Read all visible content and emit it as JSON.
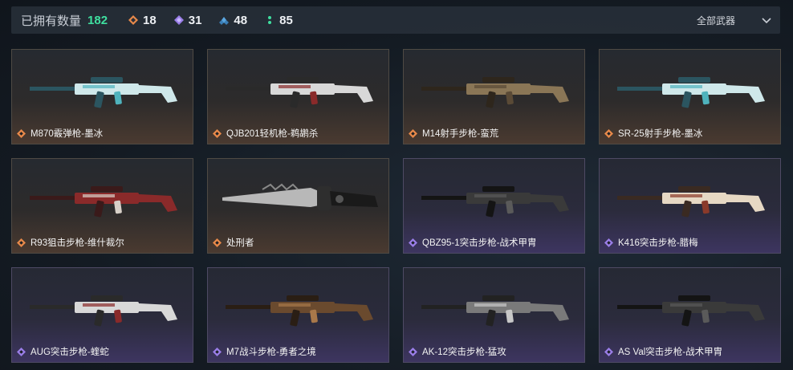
{
  "header": {
    "owned_label": "已拥有数量",
    "owned_count": "182",
    "stats": [
      {
        "icon": "orange-diamond-icon",
        "color": "#e8894a",
        "value": "18"
      },
      {
        "icon": "purple-diamond-icon",
        "color": "#9a7ee8",
        "value": "31"
      },
      {
        "icon": "blue-diamond-icon",
        "color": "#5aa6e0",
        "value": "48"
      },
      {
        "icon": "green-dots-icon",
        "color": "#3fe0a0",
        "value": "85"
      }
    ],
    "filter_label": "全部武器"
  },
  "weapons": [
    {
      "name": "M870霰弹枪-墨冰",
      "rarity": "orange",
      "palette": "ice"
    },
    {
      "name": "QJB201轻机枪-鹈鹕杀",
      "rarity": "orange",
      "palette": "white"
    },
    {
      "name": "M14射手步枪-蛮荒",
      "rarity": "orange",
      "palette": "tan"
    },
    {
      "name": "SR-25射手步枪-墨冰",
      "rarity": "orange",
      "palette": "ice"
    },
    {
      "name": "R93狙击步枪-维什裁尔",
      "rarity": "orange",
      "palette": "red"
    },
    {
      "name": "处刑者",
      "rarity": "orange",
      "palette": "knife"
    },
    {
      "name": "QBZ95-1突击步枪-战术甲胄",
      "rarity": "purple",
      "palette": "black"
    },
    {
      "name": "K416突击步枪-腊梅",
      "rarity": "purple",
      "palette": "cream"
    },
    {
      "name": "AUG突击步枪-蝰蛇",
      "rarity": "purple",
      "palette": "white"
    },
    {
      "name": "M7战斗步枪-勇者之境",
      "rarity": "purple",
      "palette": "bronze"
    },
    {
      "name": "AK-12突击步枪-猛攻",
      "rarity": "purple",
      "palette": "gray"
    },
    {
      "name": "AS Val突击步枪-战术甲胄",
      "rarity": "purple",
      "palette": "black"
    }
  ],
  "colors": {
    "orange": "#e8894a",
    "purple": "#9a7ee8",
    "accent_green": "#3fe0a0"
  }
}
